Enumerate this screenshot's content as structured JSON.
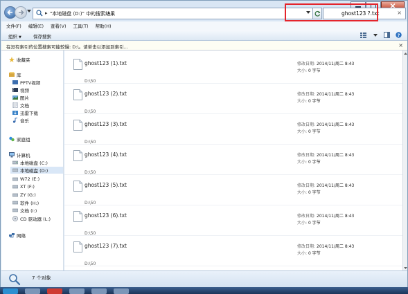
{
  "address": {
    "path_text": "\"本地磁盘 (D:)\" 中的搜索结果",
    "separator": "▸",
    "back_icon": "back-arrow-icon",
    "forward_icon": "forward-arrow-icon"
  },
  "search": {
    "value": "ghost123 ?.txt",
    "clear_glyph": "×"
  },
  "menu": {
    "items": [
      "文件(F)",
      "编辑(E)",
      "查看(V)",
      "工具(T)",
      "帮助(H)"
    ]
  },
  "toolbar": {
    "organize_label": "组织",
    "save_search_label": "保存搜索"
  },
  "info_bar": {
    "text": "在没有索引的位置搜索可能较慢: D:\\。请单击以添加到索引...",
    "close_glyph": "×"
  },
  "nav": {
    "favorites": "收藏夹",
    "libraries": "库",
    "library_items": [
      "PPTV视频",
      "视频",
      "图片",
      "文档",
      "迅雷下载",
      "音乐"
    ],
    "homegroup": "家庭组",
    "computer": "计算机",
    "drives": [
      "本地磁盘 (C:)",
      "本地磁盘 (D:)",
      "W72 (E:)",
      "XT (F:)",
      "ZY (G:)",
      "软件 (H:)",
      "文档 (I:)",
      "CD 驱动器 (L:)"
    ],
    "network": "网络"
  },
  "results": {
    "modified_label": "修改日期:",
    "size_label": "大小:",
    "files": [
      {
        "name": "ghost123 (1).txt",
        "modified": "2014/11/周二 8:43",
        "size": "0 字节",
        "path": "D:\\50"
      },
      {
        "name": "ghost123 (2).txt",
        "modified": "2014/11/周二 8:43",
        "size": "0 字节",
        "path": "D:\\50"
      },
      {
        "name": "ghost123 (3).txt",
        "modified": "2014/11/周二 8:43",
        "size": "0 字节",
        "path": "D:\\50"
      },
      {
        "name": "ghost123 (4).txt",
        "modified": "2014/11/周二 8:43",
        "size": "0 字节",
        "path": "D:\\50"
      },
      {
        "name": "ghost123 (5).txt",
        "modified": "2014/11/周二 8:43",
        "size": "0 字节",
        "path": "D:\\50"
      },
      {
        "name": "ghost123 (6).txt",
        "modified": "2014/11/周二 8:43",
        "size": "0 字节",
        "path": "D:\\50"
      },
      {
        "name": "ghost123 (7).txt",
        "modified": "2014/11/周二 8:43",
        "size": "0 字节",
        "path": "D:\\50"
      }
    ]
  },
  "details": {
    "count_text": "7 个对象"
  },
  "colors": {
    "highlight_border": "#e4242b",
    "window_frame": "#d9e6f4"
  }
}
